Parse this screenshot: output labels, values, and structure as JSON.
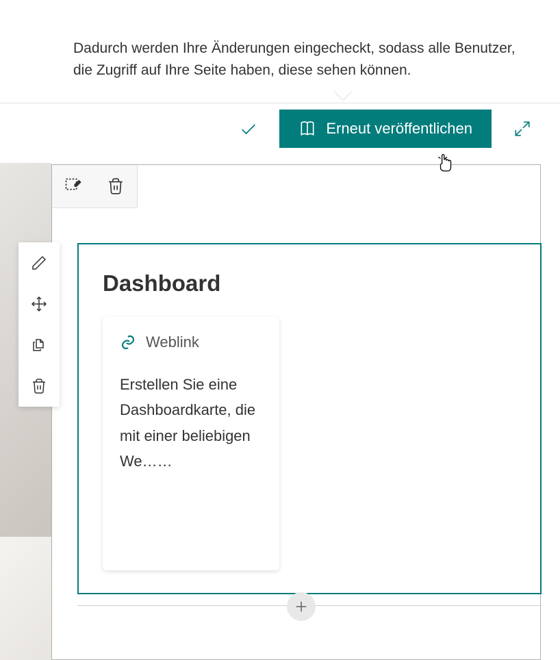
{
  "tooltip": {
    "text": "Dadurch werden Ihre Änderungen eingecheckt, sodass alle Benutzer, die Zugriff auf Ihre Seite haben, diese sehen können."
  },
  "toolbar": {
    "publish_label": "Erneut veröffentlichen"
  },
  "dashboard": {
    "title": "Dashboard",
    "card": {
      "title": "Weblink",
      "text": "Erstellen Sie eine Dashboardkarte, die mit einer beliebigen We……"
    }
  },
  "colors": {
    "primary": "#037c7c"
  }
}
